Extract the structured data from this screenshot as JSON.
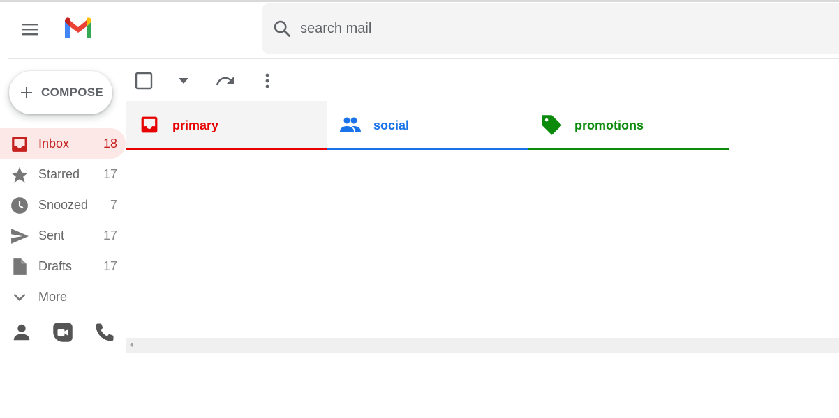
{
  "search": {
    "placeholder": "search mail",
    "icon": "search-icon"
  },
  "compose": {
    "label": "COMPOSE"
  },
  "sidebar": {
    "items": [
      {
        "label": "Inbox",
        "count": "18",
        "icon": "inbox-icon",
        "active": true
      },
      {
        "label": "Starred",
        "count": "17",
        "icon": "star-icon"
      },
      {
        "label": "Snoozed",
        "count": "7",
        "icon": "clock-icon"
      },
      {
        "label": "Sent",
        "count": "17",
        "icon": "send-icon"
      },
      {
        "label": "Drafts",
        "count": "17",
        "icon": "draft-icon"
      },
      {
        "label": "More",
        "count": "",
        "icon": "chevron-down-icon"
      }
    ]
  },
  "tabs": [
    {
      "label": "primary",
      "color": "#e60000",
      "active": true
    },
    {
      "label": "social",
      "color": "#1a73e8"
    },
    {
      "label": "promotions",
      "color": "#0b8a0b"
    }
  ],
  "colors": {
    "accent_red": "#c5221f",
    "active_bg": "#fce8e6",
    "search_bg": "#f4f4f4"
  }
}
